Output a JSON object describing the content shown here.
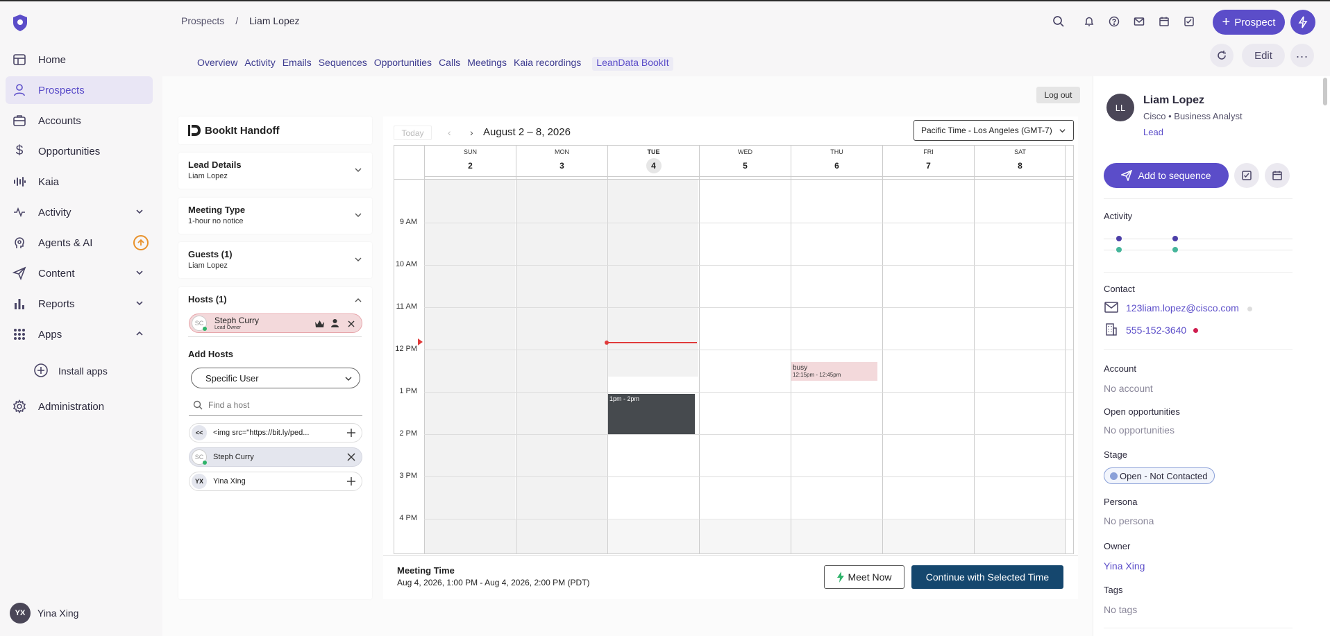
{
  "breadcrumb": {
    "parent": "Prospects",
    "separator": "/",
    "current": "Liam Lopez"
  },
  "sidebar": {
    "items": [
      {
        "label": "Home"
      },
      {
        "label": "Prospects"
      },
      {
        "label": "Accounts"
      },
      {
        "label": "Opportunities"
      },
      {
        "label": "Kaia"
      },
      {
        "label": "Activity"
      },
      {
        "label": "Agents & AI"
      },
      {
        "label": "Content"
      },
      {
        "label": "Reports"
      },
      {
        "label": "Apps"
      },
      {
        "label": "Administration"
      }
    ],
    "install_apps": "Install apps",
    "user": {
      "initials": "YX",
      "name": "Yina Xing"
    }
  },
  "header": {
    "prospect_button": "Prospect",
    "edit_button": "Edit"
  },
  "tabs": [
    "Overview",
    "Activity",
    "Emails",
    "Sequences",
    "Opportunities",
    "Calls",
    "Meetings",
    "Kaia recordings",
    "LeanData BookIt"
  ],
  "bookit": {
    "logout": "Log out",
    "title": "BookIt Handoff",
    "lead_details": {
      "title": "Lead Details",
      "value": "Liam Lopez"
    },
    "meeting_type": {
      "title": "Meeting Type",
      "value": "1-hour no notice"
    },
    "guests": {
      "title": "Guests (1)",
      "value": "Liam Lopez"
    },
    "hosts": {
      "title": "Hosts (1)",
      "chip_initials": "SC",
      "chip_name": "Steph Curry",
      "chip_role": "Lead Owner"
    },
    "add_hosts": "Add Hosts",
    "select_value": "Specific User",
    "find_placeholder": "Find a host",
    "host_list": [
      {
        "initials": "<<",
        "name": "<img src=\"https://bit.ly/ped..."
      },
      {
        "initials": "SC",
        "name": "Steph Curry"
      },
      {
        "initials": "YX",
        "name": "Yina Xing"
      }
    ]
  },
  "calendar": {
    "today": "Today",
    "prev": "‹",
    "next": "›",
    "range": "August 2 – 8, 2026",
    "timezone": "Pacific Time - Los Angeles (GMT-7)",
    "days": [
      {
        "name": "SUN",
        "num": "2"
      },
      {
        "name": "MON",
        "num": "3"
      },
      {
        "name": "TUE",
        "num": "4"
      },
      {
        "name": "WED",
        "num": "5"
      },
      {
        "name": "THU",
        "num": "6"
      },
      {
        "name": "FRI",
        "num": "7"
      },
      {
        "name": "SAT",
        "num": "8"
      }
    ],
    "hours": [
      "9 AM",
      "10 AM",
      "11 AM",
      "12 PM",
      "1 PM",
      "2 PM",
      "3 PM",
      "4 PM"
    ],
    "busy_event": {
      "title": "busy",
      "time": "12:15pm - 12:45pm"
    },
    "selected_event": {
      "time": "1pm - 2pm"
    }
  },
  "meeting": {
    "label": "Meeting Time",
    "value": "Aug 4, 2026, 1:00 PM - Aug 4, 2026, 2:00 PM (PDT)",
    "meet_now": "Meet Now",
    "continue": "Continue with Selected Time"
  },
  "right_panel": {
    "initials": "LL",
    "name": "Liam Lopez",
    "subtitle": "Cisco • Business Analyst",
    "lead": "Lead",
    "add_to_sequence": "Add to sequence",
    "activity_label": "Activity",
    "contact_label": "Contact",
    "email": "123liam.lopez@cisco.com",
    "phone": "555-152-3640",
    "account_label": "Account",
    "account_value": "No account",
    "opps_label": "Open opportunities",
    "opps_value": "No opportunities",
    "stage_label": "Stage",
    "stage_value": "Open - Not Contacted",
    "persona_label": "Persona",
    "persona_value": "No persona",
    "owner_label": "Owner",
    "owner_value": "Yina Xing",
    "tags_label": "Tags",
    "tags_value": "No tags"
  },
  "colors": {
    "brand": "#5b4dc9",
    "continue": "#15476e",
    "busy": "#f3d9db",
    "selected_event": "#464a4e",
    "now_line": "#e03a3a"
  }
}
